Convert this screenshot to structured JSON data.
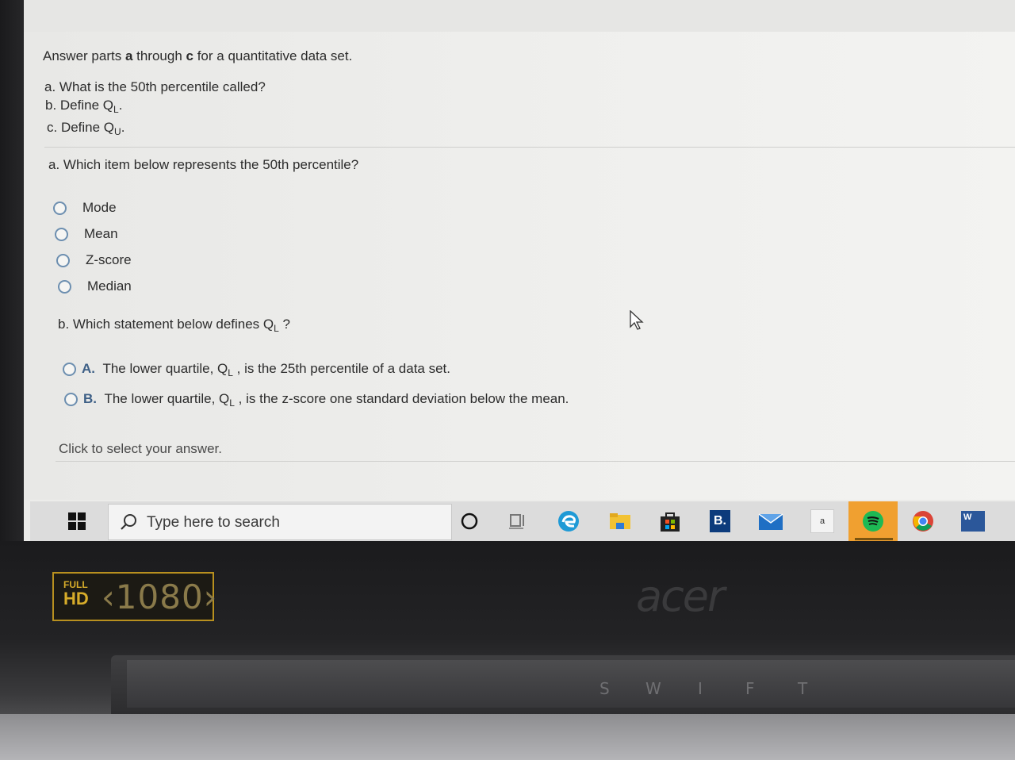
{
  "question": {
    "intro_prefix": "Answer parts ",
    "intro_a": "a",
    "intro_mid": " through ",
    "intro_c": "c",
    "intro_suffix": " for a quantitative data set.",
    "part_a": "a. What is the 50th percentile called?",
    "part_b_prefix": "b. Define Q",
    "part_b_sub": "L",
    "part_b_suffix": ".",
    "part_c_prefix": "c. Define Q",
    "part_c_sub": "U",
    "part_c_suffix": "."
  },
  "section_a": {
    "prompt": "a. Which item below represents the 50th percentile?",
    "options": [
      "Mode",
      "Mean",
      "Z-score",
      "Median"
    ]
  },
  "section_b": {
    "prompt_prefix": "b. Which statement below defines Q",
    "prompt_sub": "L",
    "prompt_suffix": " ?",
    "options": [
      {
        "letter": "A.",
        "prefix": "The lower quartile, Q",
        "sub": "L",
        "suffix": " , is the 25th percentile of a data set."
      },
      {
        "letter": "B.",
        "prefix": "The lower quartile, Q",
        "sub": "L",
        "suffix": " , is the z-score one standard deviation below the mean."
      }
    ]
  },
  "footer_hint": "Click to select your answer.",
  "taskbar": {
    "search_placeholder": "Type here to search",
    "store_letter": "B.",
    "word_letter": "W",
    "amazon_letter": "a",
    "icons": [
      "windows-start-icon",
      "search-icon",
      "cortana-circle-icon",
      "task-view-icon",
      "edge-icon",
      "file-explorer-icon",
      "store-icon",
      "booking-icon",
      "mail-icon",
      "amazon-icon",
      "spotify-icon",
      "chrome-icon",
      "word-icon"
    ]
  },
  "hardware": {
    "badge_full": "FULL",
    "badge_hd": "HD",
    "badge_res": "‹1080›",
    "brand": "acer",
    "keys": [
      "S",
      "W",
      "I",
      "F",
      "T"
    ]
  },
  "colors": {
    "radio_border": "#6d8fb0",
    "taskbar_bg": "#dcdcdc",
    "spotify_highlight": "#f0a030"
  }
}
